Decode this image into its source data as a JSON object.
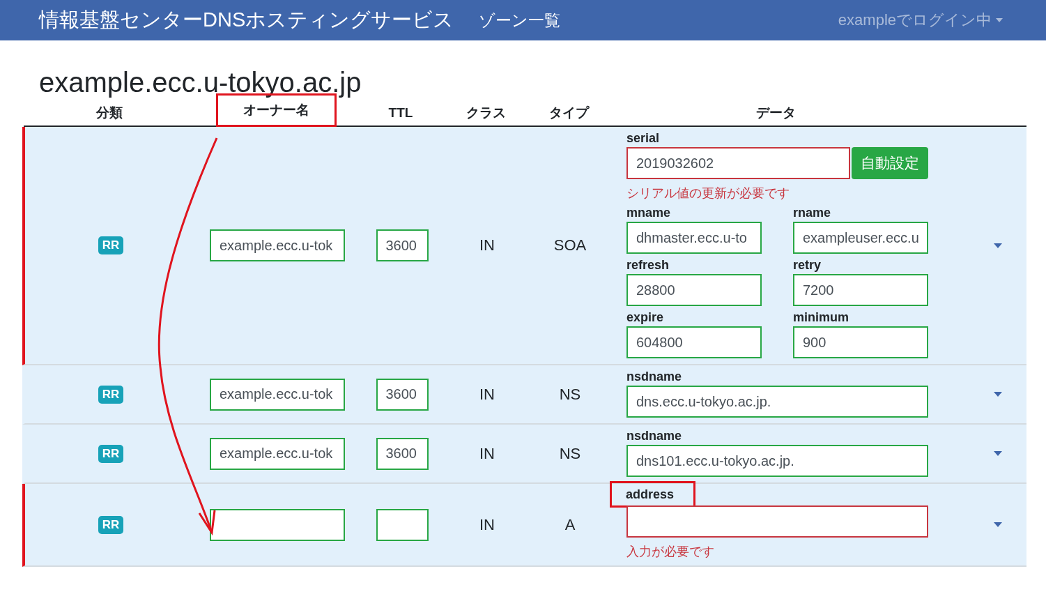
{
  "navbar": {
    "brand": "情報基盤センターDNSホスティングサービス",
    "link": "ゾーン一覧",
    "user_menu": "exampleでログイン中"
  },
  "zone_title": "example.ecc.u-tokyo.ac.jp",
  "columns": [
    {
      "label": "分類",
      "highlighted": false
    },
    {
      "label": "オーナー名",
      "highlighted": true
    },
    {
      "label": "TTL",
      "highlighted": false
    },
    {
      "label": "クラス",
      "highlighted": false
    },
    {
      "label": "タイプ",
      "highlighted": false
    },
    {
      "label": "データ",
      "highlighted": false
    }
  ],
  "records": [
    {
      "category": "RR",
      "owner": "example.ecc.u-tok",
      "ttl": "3600",
      "class": "IN",
      "type": "SOA",
      "highlighted": true,
      "fields": [
        {
          "kind": "wide",
          "label": "serial",
          "value": "2019032602",
          "invalid": true,
          "highlighted": false,
          "button": "自動設定",
          "error": "シリアル値の更新が必要です"
        },
        {
          "kind": "half",
          "label": "mname",
          "value": "dhmaster.ecc.u-to",
          "invalid": false,
          "highlighted": false
        },
        {
          "kind": "half",
          "label": "rname",
          "value": "exampleuser.ecc.u",
          "invalid": false,
          "highlighted": false
        },
        {
          "kind": "half",
          "label": "refresh",
          "value": "28800",
          "invalid": false,
          "highlighted": false
        },
        {
          "kind": "half",
          "label": "retry",
          "value": "7200",
          "invalid": false,
          "highlighted": false
        },
        {
          "kind": "half",
          "label": "expire",
          "value": "604800",
          "invalid": false,
          "highlighted": false
        },
        {
          "kind": "half",
          "label": "minimum",
          "value": "900",
          "invalid": false,
          "highlighted": false
        }
      ]
    },
    {
      "category": "RR",
      "owner": "example.ecc.u-tok",
      "ttl": "3600",
      "class": "IN",
      "type": "NS",
      "highlighted": false,
      "fields": [
        {
          "kind": "wide",
          "label": "nsdname",
          "value": "dns.ecc.u-tokyo.ac.jp.",
          "invalid": false,
          "highlighted": false
        }
      ]
    },
    {
      "category": "RR",
      "owner": "example.ecc.u-tok",
      "ttl": "3600",
      "class": "IN",
      "type": "NS",
      "highlighted": false,
      "fields": [
        {
          "kind": "wide",
          "label": "nsdname",
          "value": "dns101.ecc.u-tokyo.ac.jp.",
          "invalid": false,
          "highlighted": false
        }
      ]
    },
    {
      "category": "RR",
      "class": "IN",
      "type": "A",
      "highlighted": true,
      "fields": [
        {
          "kind": "wide",
          "label": "address",
          "invalid": true,
          "highlighted": true,
          "error": "入力が必要です"
        }
      ]
    }
  ]
}
